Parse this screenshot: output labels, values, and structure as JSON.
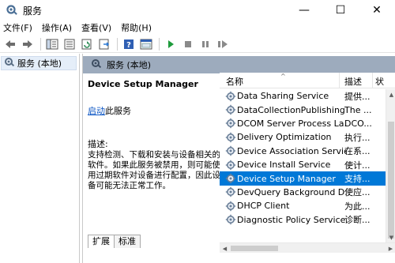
{
  "window": {
    "title": "服务",
    "minimize": "—",
    "maximize": "☐",
    "close": "✕"
  },
  "menu": [
    "文件(F)",
    "操作(A)",
    "查看(V)",
    "帮助(H)"
  ],
  "toolbar": {
    "icons": [
      "back-arrow-icon",
      "forward-arrow-icon",
      "console-tree-icon",
      "properties-icon",
      "refresh-icon",
      "export-list-icon",
      "help-icon",
      "console-icon",
      "start-service-icon",
      "stop-service-icon",
      "pause-service-icon",
      "restart-service-icon"
    ]
  },
  "tree": {
    "item_label": "服务 (本地)"
  },
  "pane_header": {
    "label": "服务 (本地)"
  },
  "description": {
    "title": "Device Setup Manager",
    "start_link": "启动",
    "start_suffix": "此服务",
    "desc_label": "描述:",
    "desc_text": "支持检测、下载和安装与设备相关的软件。如果此服务被禁用，则可能使用过期软件对设备进行配置，因此设备可能无法正常工作。"
  },
  "list": {
    "columns": {
      "name": "名称",
      "description": "描述",
      "state": "状"
    },
    "sort_indicator": "^",
    "rows": [
      {
        "name": "Data Sharing Service",
        "desc": "提供..."
      },
      {
        "name": "DataCollectionPublishing...",
        "desc": "The ..."
      },
      {
        "name": "DCOM Server Process La...",
        "desc": "DCO..."
      },
      {
        "name": "Delivery Optimization",
        "desc": "执行..."
      },
      {
        "name": "Device Association Service",
        "desc": "在系..."
      },
      {
        "name": "Device Install Service",
        "desc": "使计..."
      },
      {
        "name": "Device Setup Manager",
        "desc": "支持...",
        "selected": true
      },
      {
        "name": "DevQuery Background D...",
        "desc": "使应..."
      },
      {
        "name": "DHCP Client",
        "desc": "为此..."
      },
      {
        "name": "Diagnostic Policy Service",
        "desc": "诊断..."
      }
    ]
  },
  "tabs": [
    "扩展",
    "标准"
  ],
  "colors": {
    "selection": "#0078d7",
    "pane_header": "#9dabbd",
    "link": "#0b55c4"
  }
}
